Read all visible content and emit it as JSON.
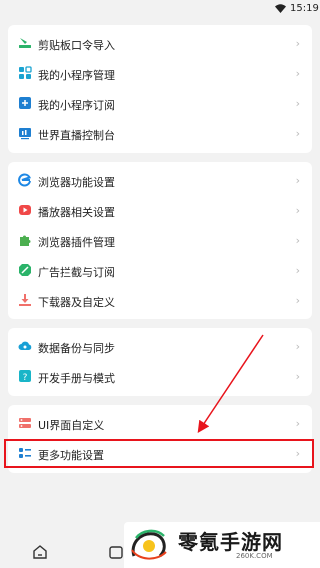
{
  "status": {
    "time": "15:19"
  },
  "group1": [
    {
      "label": "剪贴板口令导入",
      "icon": "clipboard-import-icon"
    },
    {
      "label": "我的小程序管理",
      "icon": "mini-program-manage-icon"
    },
    {
      "label": "我的小程序订阅",
      "icon": "mini-program-subscribe-icon"
    },
    {
      "label": "世界直播控制台",
      "icon": "live-console-icon"
    }
  ],
  "group2": [
    {
      "label": "浏览器功能设置",
      "icon": "browser-icon"
    },
    {
      "label": "播放器相关设置",
      "icon": "player-icon"
    },
    {
      "label": "浏览器插件管理",
      "icon": "plugin-icon"
    },
    {
      "label": "广告拦截与订阅",
      "icon": "adblock-icon"
    },
    {
      "label": "下载器及自定义",
      "icon": "download-icon"
    }
  ],
  "group3": [
    {
      "label": "数据备份与同步",
      "icon": "cloud-sync-icon"
    },
    {
      "label": "开发手册与模式",
      "icon": "dev-manual-icon"
    }
  ],
  "group4": [
    {
      "label": "UI界面自定义",
      "icon": "ui-custom-icon"
    },
    {
      "label": "更多功能设置",
      "icon": "more-settings-icon"
    }
  ],
  "chevron": "›",
  "watermark": {
    "brand": "零氪手游网",
    "site": "260K.COM"
  },
  "colors": {
    "accent_green": "#2bb36a",
    "highlight_red": "#e8141c"
  }
}
